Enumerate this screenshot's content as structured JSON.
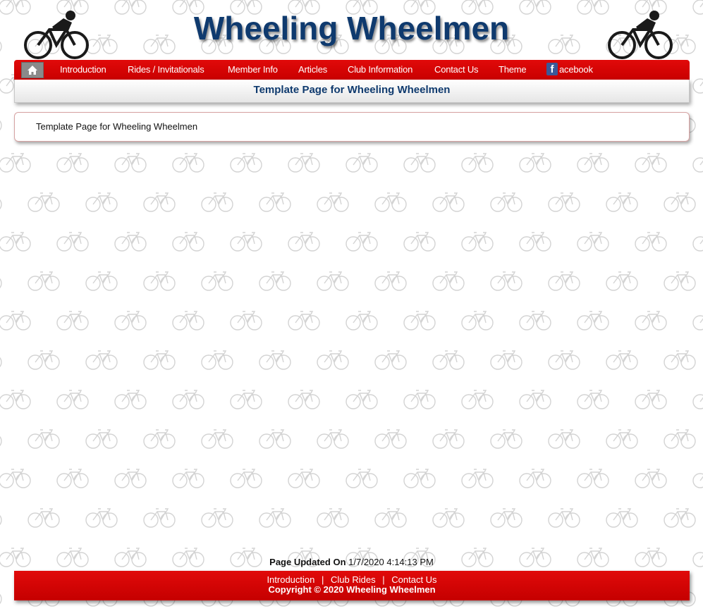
{
  "header": {
    "site_title": "Wheeling Wheelmen"
  },
  "nav": {
    "home_icon": "home-icon",
    "items": [
      {
        "label": "Introduction"
      },
      {
        "label": "Rides / Invitationals"
      },
      {
        "label": "Member Info"
      },
      {
        "label": "Articles"
      },
      {
        "label": "Club Information"
      },
      {
        "label": "Contact Us"
      },
      {
        "label": "Theme"
      }
    ],
    "facebook": {
      "icon_letter": "f",
      "label": "acebook"
    }
  },
  "page": {
    "title": "Template Page for Wheeling Wheelmen",
    "content": "Template Page for Wheeling Wheelmen"
  },
  "footer": {
    "updated_label": "Page Updated On",
    "updated_value": "1/7/2020 4:14:13 PM",
    "links": [
      {
        "label": "Introduction"
      },
      {
        "label": "Club Rides"
      },
      {
        "label": "Contact Us"
      }
    ],
    "separator": "|",
    "copyright": "Copyright © 2020 Wheeling Wheelmen"
  },
  "colors": {
    "nav_red": "#d40000",
    "title_blue": "#0f3a6e",
    "pattern_gray": "#cfcfcf"
  }
}
